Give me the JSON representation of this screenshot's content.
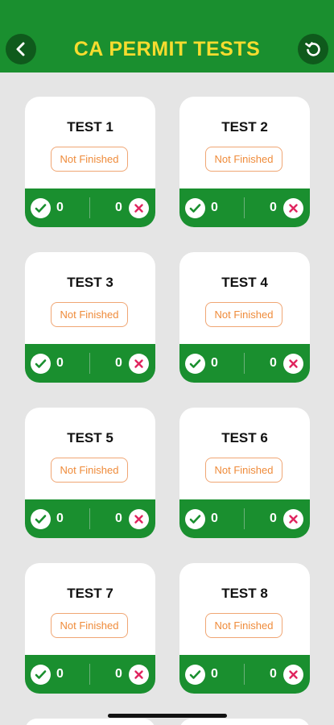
{
  "header": {
    "title": "CA PERMIT TESTS",
    "back_icon": "chevron-left-icon",
    "reset_icon": "reset-icon"
  },
  "colors": {
    "header_bg": "#1a8f2f",
    "title": "#f7dc2f",
    "status": "#ef8b3a",
    "wrong": "#e0245e"
  },
  "tests": [
    {
      "title": "TEST 1",
      "status": "Not Finished",
      "correct": "0",
      "wrong": "0"
    },
    {
      "title": "TEST 2",
      "status": "Not Finished",
      "correct": "0",
      "wrong": "0"
    },
    {
      "title": "TEST 3",
      "status": "Not Finished",
      "correct": "0",
      "wrong": "0"
    },
    {
      "title": "TEST 4",
      "status": "Not Finished",
      "correct": "0",
      "wrong": "0"
    },
    {
      "title": "TEST 5",
      "status": "Not Finished",
      "correct": "0",
      "wrong": "0"
    },
    {
      "title": "TEST 6",
      "status": "Not Finished",
      "correct": "0",
      "wrong": "0"
    },
    {
      "title": "TEST 7",
      "status": "Not Finished",
      "correct": "0",
      "wrong": "0"
    },
    {
      "title": "TEST 8",
      "status": "Not Finished",
      "correct": "0",
      "wrong": "0"
    }
  ]
}
